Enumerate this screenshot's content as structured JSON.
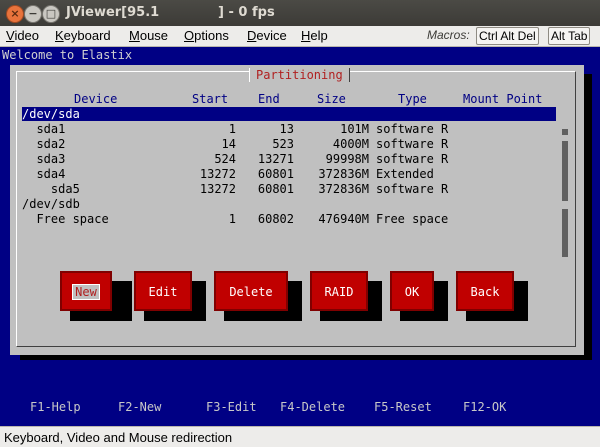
{
  "window": {
    "title": "JViewer[95.1             ] - 0 fps",
    "close_glyph": "×",
    "min_glyph": "−",
    "max_glyph": "□"
  },
  "menubar": {
    "items": [
      {
        "label": "Video"
      },
      {
        "label": "Keyboard"
      },
      {
        "label": "Mouse"
      },
      {
        "label": "Options"
      },
      {
        "label": "Device"
      },
      {
        "label": "Help"
      }
    ],
    "macros_label": "Macros:",
    "macro_buttons": [
      {
        "label": "Ctrl Alt Del"
      },
      {
        "label": "Alt Tab"
      }
    ]
  },
  "console": {
    "welcome": "Welcome to Elastix",
    "dialog_title": "Partitioning",
    "columns": [
      "Device",
      "Start",
      "End",
      "Size",
      "Type",
      "Mount Point"
    ],
    "rows": [
      {
        "device": "/dev/sda",
        "start": "",
        "end": "",
        "size": "",
        "type": "",
        "mount": "",
        "selected": true
      },
      {
        "device": "  sda1",
        "start": "1",
        "end": "13",
        "size": "101M",
        "type": "software R",
        "mount": ""
      },
      {
        "device": "  sda2",
        "start": "14",
        "end": "523",
        "size": "4000M",
        "type": "software R",
        "mount": ""
      },
      {
        "device": "  sda3",
        "start": "524",
        "end": "13271",
        "size": "99998M",
        "type": "software R",
        "mount": ""
      },
      {
        "device": "  sda4",
        "start": "13272",
        "end": "60801",
        "size": "372836M",
        "type": "Extended",
        "mount": ""
      },
      {
        "device": "    sda5",
        "start": "13272",
        "end": "60801",
        "size": "372836M",
        "type": "software R",
        "mount": ""
      },
      {
        "device": "/dev/sdb",
        "start": "",
        "end": "",
        "size": "",
        "type": "",
        "mount": ""
      },
      {
        "device": "  Free space",
        "start": "1",
        "end": "60802",
        "size": "476940M",
        "type": "Free space",
        "mount": ""
      }
    ],
    "buttons": [
      {
        "label": "New",
        "focused": true
      },
      {
        "label": "Edit"
      },
      {
        "label": "Delete"
      },
      {
        "label": "RAID"
      },
      {
        "label": "OK"
      },
      {
        "label": "Back"
      }
    ],
    "function_keys": [
      "F1-Help",
      "F2-New",
      "F3-Edit",
      "F4-Delete",
      "F5-Reset",
      "F12-OK"
    ]
  },
  "statusbar": {
    "text": "Keyboard, Video and Mouse redirection"
  },
  "colors": {
    "console_bg": "#000084",
    "dialog_bg": "#c0c0c0",
    "button_bg": "#c00000",
    "title_accent": "#b02020"
  }
}
